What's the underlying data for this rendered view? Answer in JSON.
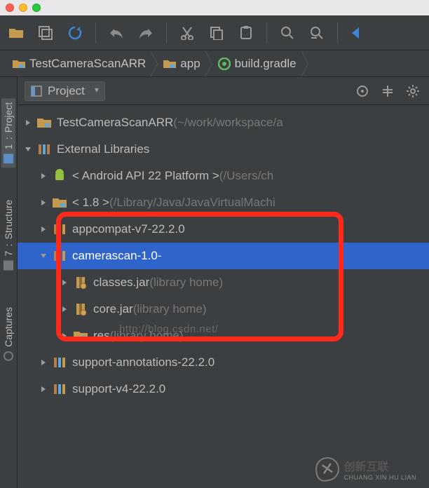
{
  "titlebar": {},
  "toolbar": {
    "icons": [
      "folder-open-icon",
      "save-icon",
      "refresh-icon",
      "undo-icon",
      "redo-icon",
      "cut-icon",
      "copy-icon",
      "paste-icon",
      "search-icon",
      "search-replace-icon",
      "back-icon"
    ]
  },
  "breadcrumb": {
    "items": [
      {
        "icon": "folder",
        "label": "TestCameraScanARR"
      },
      {
        "icon": "folder",
        "label": "app"
      },
      {
        "icon": "gradle",
        "label": "build.gradle"
      }
    ]
  },
  "gutter": {
    "tabs": [
      {
        "num": "1",
        "label": "Project",
        "active": true
      },
      {
        "num": "7",
        "label": "Structure",
        "active": false
      },
      {
        "num": "",
        "label": "Captures",
        "active": false
      }
    ]
  },
  "panel": {
    "title": "Project",
    "actions": [
      "target-icon",
      "collapse-icon",
      "gear-icon"
    ]
  },
  "tree": {
    "rows": [
      {
        "depth": 0,
        "arrow": "right",
        "icon": "module",
        "name": "TestCameraScanARR",
        "suffix": "(~/work/workspace/a"
      },
      {
        "depth": 0,
        "arrow": "down",
        "icon": "lib-group",
        "name": "External Libraries",
        "suffix": ""
      },
      {
        "depth": 1,
        "arrow": "right",
        "icon": "android",
        "name": "< Android API 22 Platform >",
        "suffix": "(/Users/ch"
      },
      {
        "depth": 1,
        "arrow": "right",
        "icon": "module",
        "name": "< 1.8 >",
        "suffix": "(/Library/Java/JavaVirtualMachi"
      },
      {
        "depth": 1,
        "arrow": "right",
        "icon": "lib",
        "name": "appcompat-v7-22.2.0",
        "suffix": ""
      },
      {
        "depth": 1,
        "arrow": "down",
        "icon": "lib",
        "name": "camerascan-1.0-",
        "suffix": "",
        "selected": true
      },
      {
        "depth": 2,
        "arrow": "right",
        "icon": "jar",
        "name": "classes.jar",
        "suffix": "(library home)"
      },
      {
        "depth": 2,
        "arrow": "right",
        "icon": "jar",
        "name": "core.jar",
        "suffix": "(library home)"
      },
      {
        "depth": 2,
        "arrow": "right",
        "icon": "folder-res",
        "name": "res",
        "suffix": "(library home)"
      },
      {
        "depth": 1,
        "arrow": "right",
        "icon": "lib",
        "name": "support-annotations-22.2.0",
        "suffix": ""
      },
      {
        "depth": 1,
        "arrow": "right",
        "icon": "lib",
        "name": "support-v4-22.2.0",
        "suffix": ""
      }
    ]
  },
  "watermark": {
    "url": "http://blog.csdn.net/",
    "brand_cn": "创新互联",
    "brand_py": "CHUANG XIN HU LIAN"
  }
}
